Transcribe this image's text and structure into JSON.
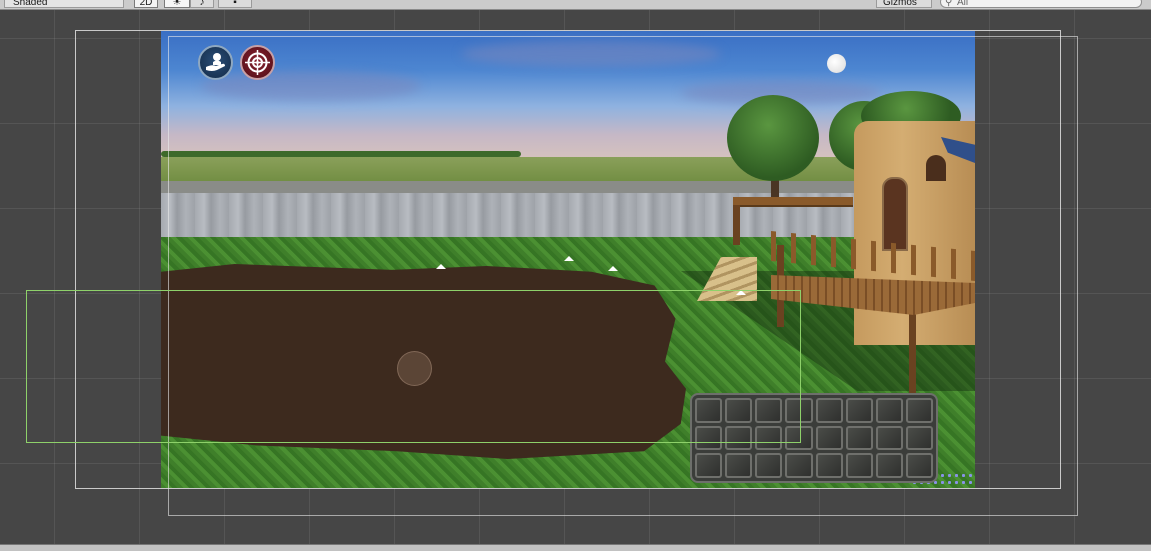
{
  "toolbar": {
    "shading_mode": "Shaded",
    "view_mode_2d": "2D",
    "gizmos_label": "Gizmos",
    "search_placeholder": "All",
    "icons": {
      "lighting": "lighting-toggle-icon",
      "audio": "audio-toggle-icon",
      "effects": "effects-toggle-icon",
      "search": "search-icon"
    }
  },
  "scene": {
    "background_color": "#464646",
    "grid_color": "#5a5a5a",
    "gizmo_frame_color": "#eaeaea",
    "selection_frame_color": "#8ed16a",
    "hud": {
      "left_icon": "hand-icon",
      "right_icon": "target-icon"
    },
    "inventory": {
      "rows": 3,
      "columns": 8,
      "slots": 24
    }
  }
}
